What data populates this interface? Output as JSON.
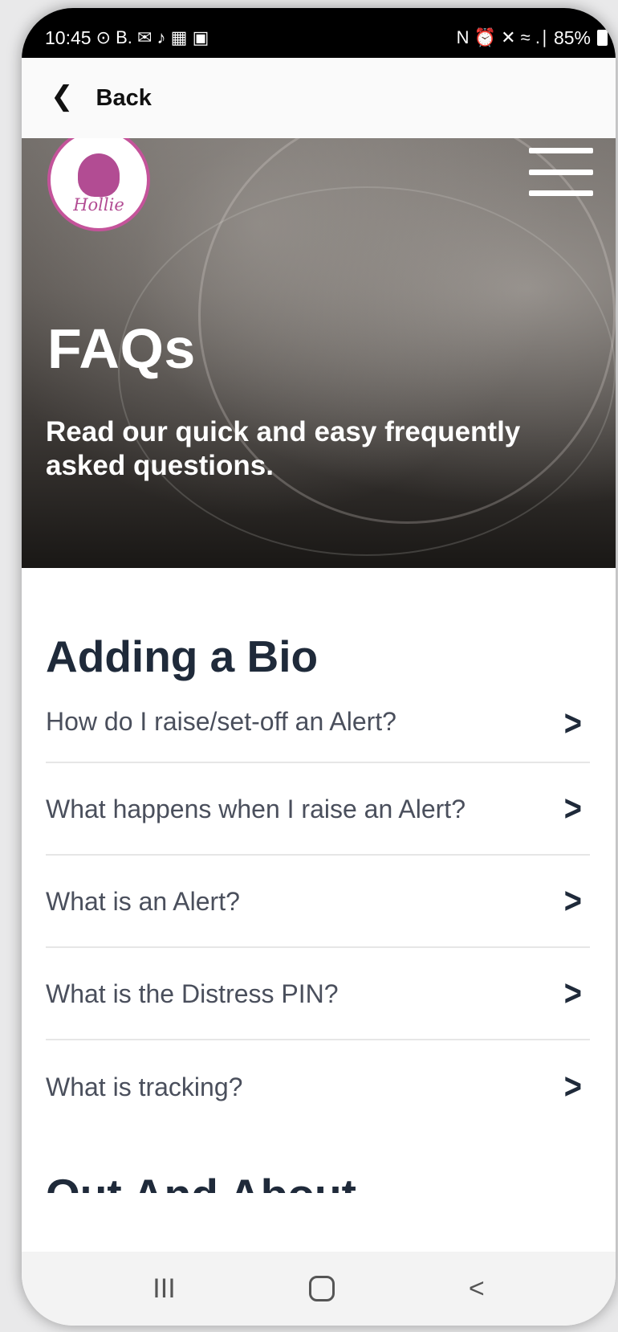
{
  "status_bar": {
    "time": "10:45",
    "left_glyphs": "⊙ B. ✉ ♪ ▦ ▣",
    "right_glyphs": "N ⏰ ✕ ≈ .∣",
    "battery": "85%"
  },
  "nav": {
    "back_label": "Back"
  },
  "hero": {
    "logo_text": "Hollie",
    "title": "FAQs",
    "subtitle": "Read our quick and easy frequently asked questions."
  },
  "section": {
    "title": "Adding a Bio",
    "items": [
      {
        "question": "How do I raise/set-off an Alert?"
      },
      {
        "question": "What happens when I raise an Alert?"
      },
      {
        "question": "What is an Alert?"
      },
      {
        "question": "What is the Distress PIN?"
      },
      {
        "question": "What is tracking?"
      }
    ]
  },
  "next_section": {
    "title": "Out And About"
  },
  "system_nav": {
    "recents": "III",
    "back": "<"
  },
  "colors": {
    "heading": "#1f2a3a",
    "question_text": "#4a4f5c",
    "logo_accent": "#c4539a"
  }
}
